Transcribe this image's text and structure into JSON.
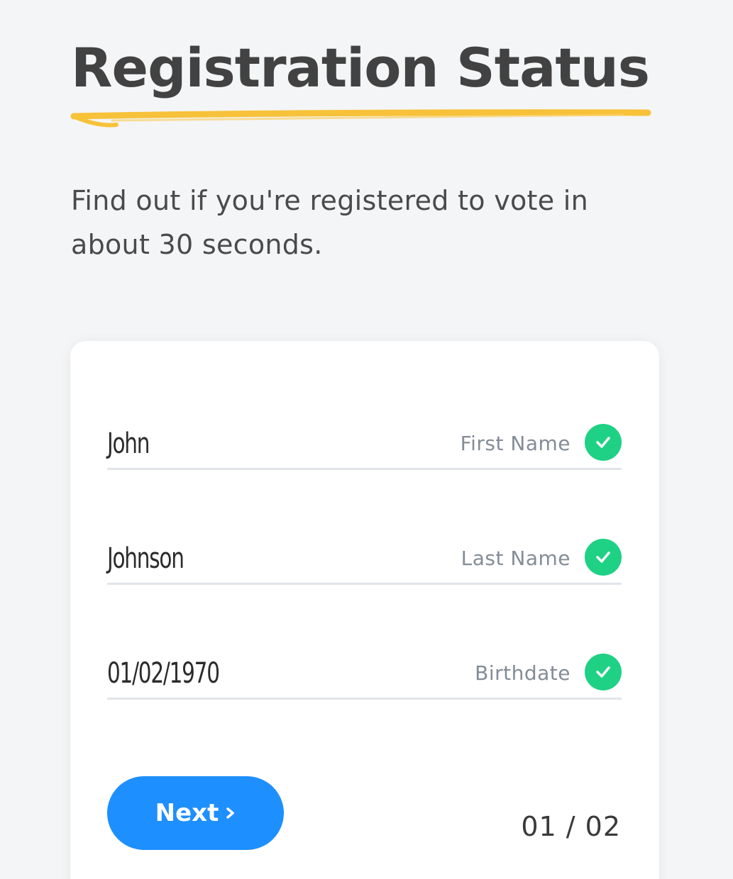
{
  "header": {
    "title": "Registration Status",
    "subtitle": "Find out if you're registered to vote in about 30 seconds."
  },
  "form": {
    "fields": [
      {
        "value": "John",
        "label": "First Name",
        "status_icon": "check-icon"
      },
      {
        "value": "Johnson",
        "label": "Last Name",
        "status_icon": "check-icon"
      },
      {
        "value": "01/02/1970",
        "label": "Birthdate",
        "status_icon": "check-icon"
      }
    ],
    "next_label": "Next",
    "next_icon": "chevron-right-icon",
    "pager": "01 / 02"
  },
  "colors": {
    "accent": "#1e8fff",
    "success": "#1fd184",
    "highlight": "#f7c23a"
  }
}
